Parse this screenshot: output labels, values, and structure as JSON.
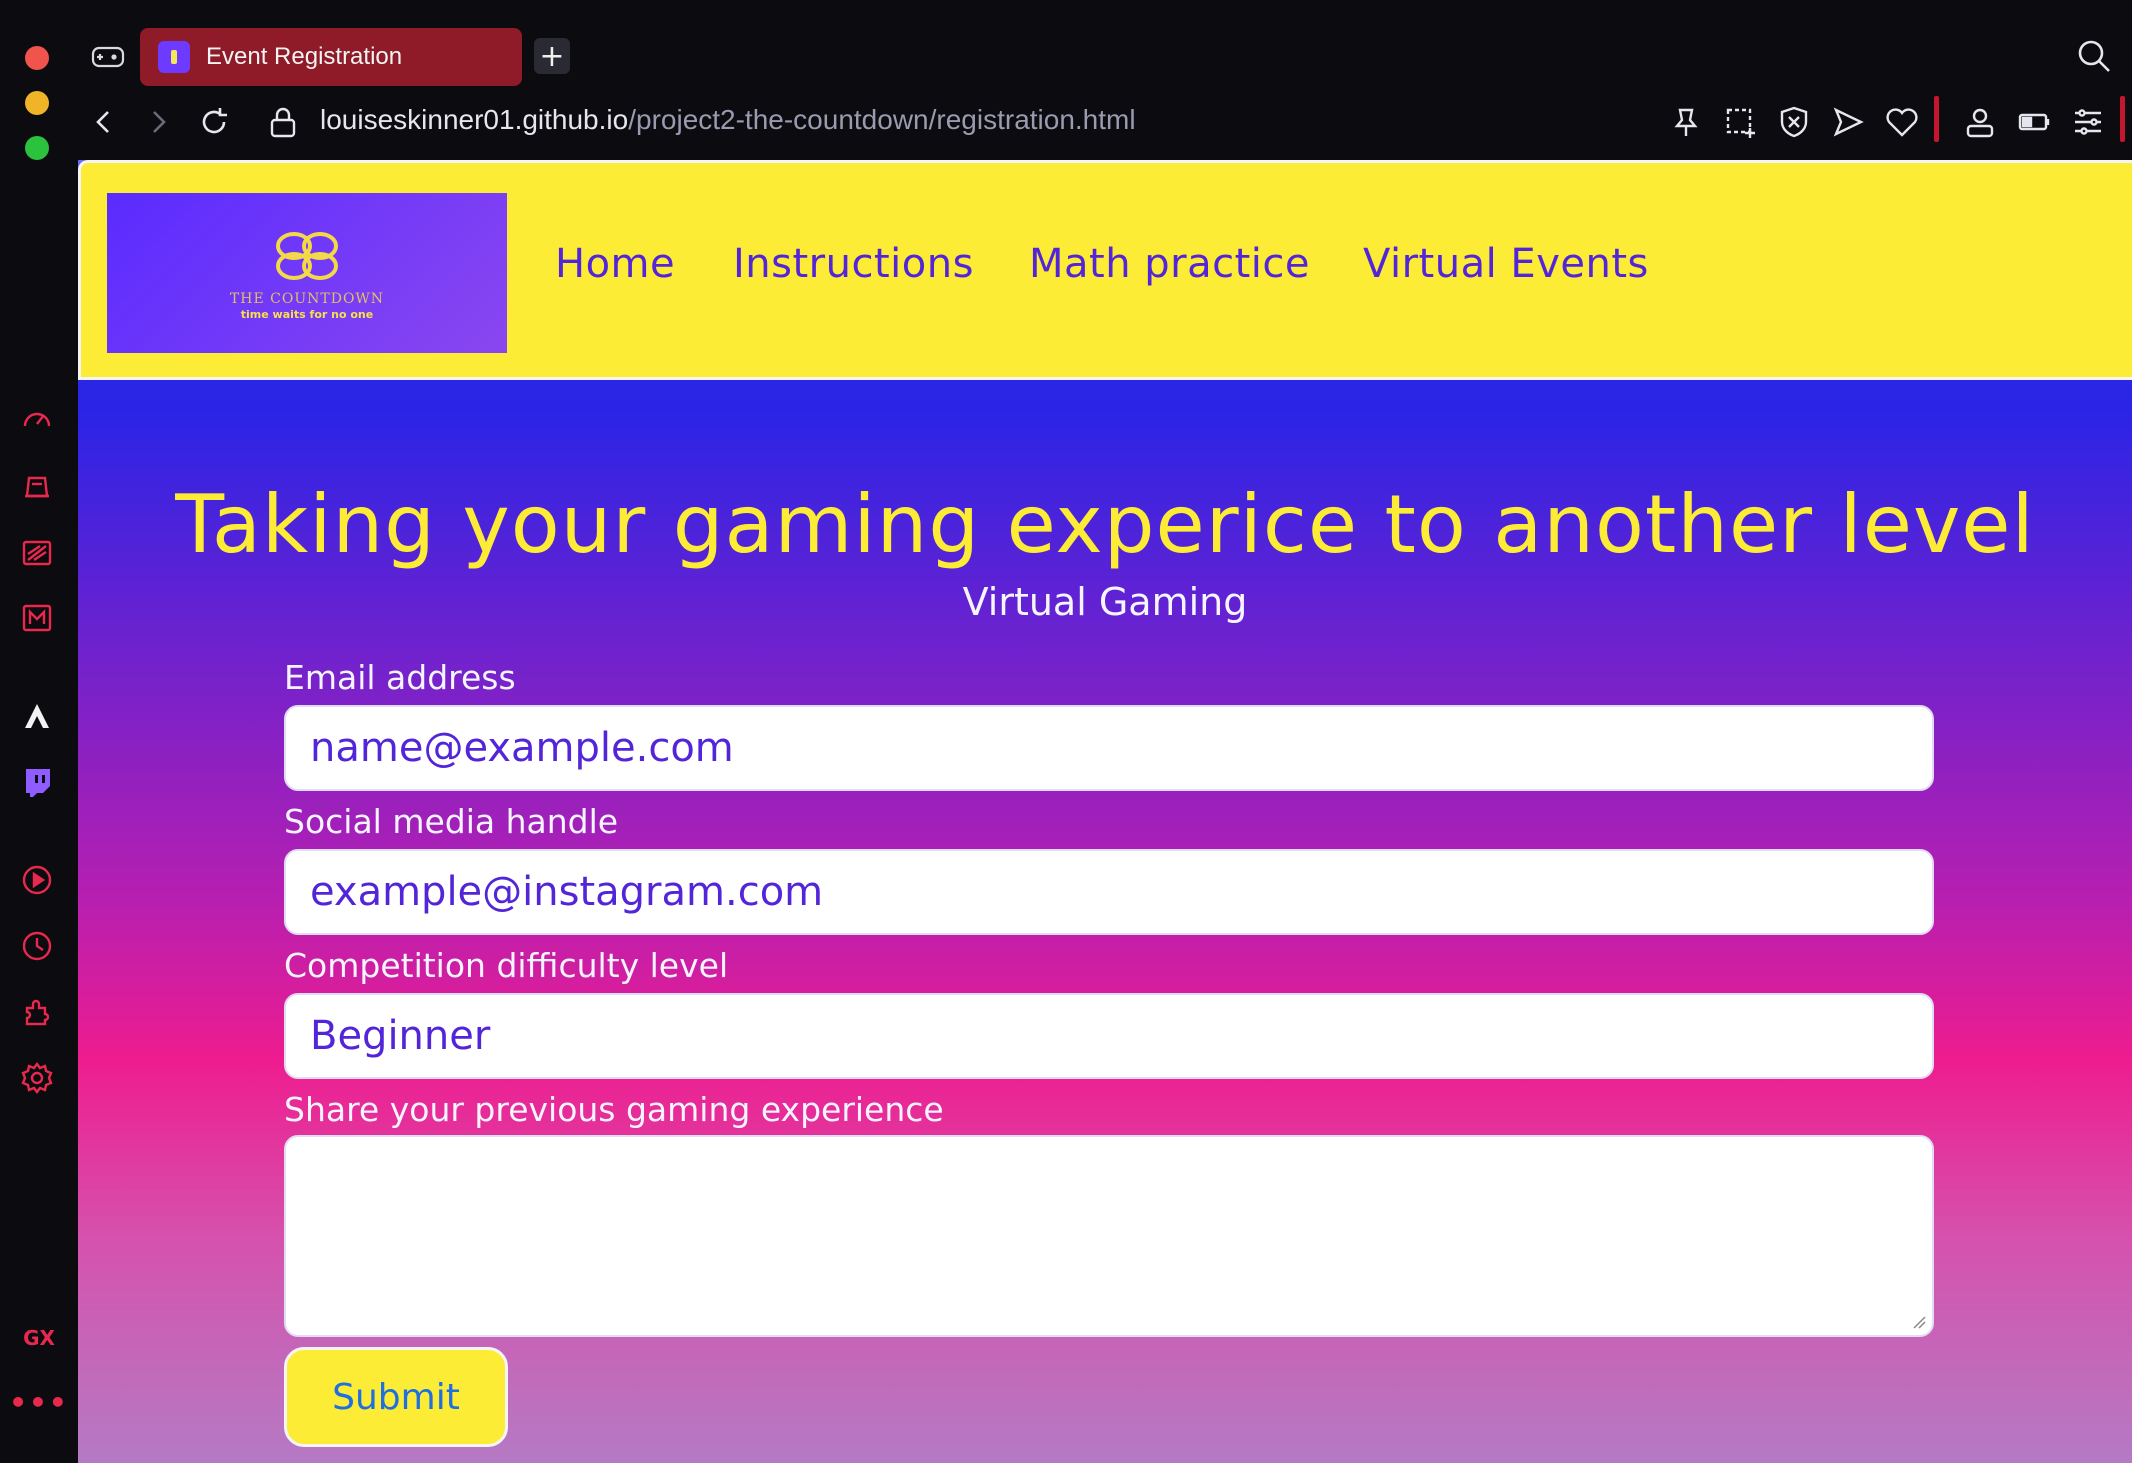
{
  "browser": {
    "tab_title": "Event Registration",
    "new_tab_label": "+",
    "url_host": "louiseskinner01.github.io",
    "url_path": "/project2-the-countdown/registration.html",
    "sidebar_gx_label": "GX",
    "sidebar_more_label": "•••"
  },
  "site": {
    "logo_name": "THE COUNTDOWN",
    "logo_tagline": "time waits for no one",
    "nav": [
      "Home",
      "Instructions",
      "Math practice",
      "Virtual Events"
    ],
    "headline": "Taking your gaming experice to another level",
    "subheading": "Virtual Gaming"
  },
  "form": {
    "email_label": "Email address",
    "email_placeholder": "name@example.com",
    "social_label": "Social media handle",
    "social_placeholder": "example@instagram.com",
    "difficulty_label": "Competition difficulty level",
    "difficulty_value": "Beginner",
    "experience_label": "Share your previous gaming experience",
    "submit_label": "Submit"
  },
  "colors": {
    "header_yellow": "#fdec35",
    "nav_purple": "#5325d9",
    "tab_red": "#8f1a28",
    "opera_accent": "#e8294d"
  }
}
